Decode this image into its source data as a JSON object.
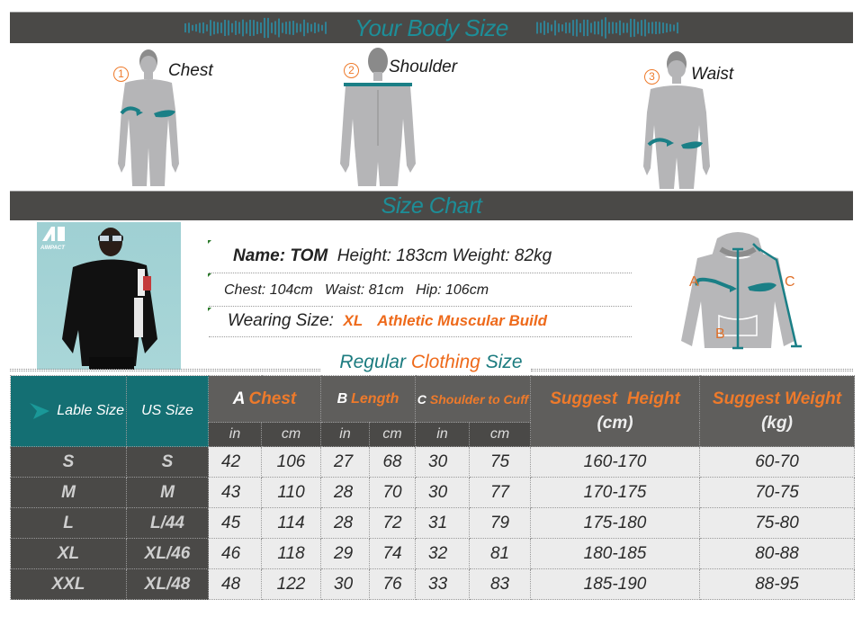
{
  "banners": {
    "body_size_title": "Your Body Size",
    "size_chart_title": "Size Chart"
  },
  "body_measurements": [
    {
      "number": "1",
      "label": "Chest",
      "icon": "chest-measure-figure"
    },
    {
      "number": "2",
      "label": "Shoulder",
      "icon": "shoulder-measure-figure"
    },
    {
      "number": "3",
      "label": "Waist",
      "icon": "waist-measure-figure"
    }
  ],
  "model": {
    "brand": "AIMPACT",
    "name_label": "Name:",
    "name": "TOM",
    "height_weight": "Height: 183cm Weight: 82kg",
    "measurements": "Chest: 104cm   Waist: 81cm   Hip: 106cm",
    "wearing_label": "Wearing Size:",
    "wearing_size": "XL",
    "build": "Athletic Muscular Build"
  },
  "garment_diagram": {
    "labels": [
      "A",
      "B",
      "C"
    ]
  },
  "subheading": {
    "part1": "Regular",
    "part2": "Clothing",
    "part3": "Size"
  },
  "table": {
    "headers": {
      "label_size": "Lable Size",
      "us_size": "US Size",
      "chest_letter": "A",
      "chest": "Chest",
      "length_letter": "B",
      "length": "Length",
      "shoulder_letter": "C",
      "shoulder": "Shoulder to Cuff",
      "height": "Suggest  Height",
      "height_unit": "(cm)",
      "weight": "Suggest Weight",
      "weight_unit": "(kg)",
      "unit_in": "in",
      "unit_cm": "cm"
    },
    "rows": [
      {
        "label": "S",
        "us": "S",
        "chest_in": "42",
        "chest_cm": "106",
        "length_in": "27",
        "length_cm": "68",
        "shoulder_in": "30",
        "shoulder_cm": "75",
        "height": "160-170",
        "weight": "60-70"
      },
      {
        "label": "M",
        "us": "M",
        "chest_in": "43",
        "chest_cm": "110",
        "length_in": "28",
        "length_cm": "70",
        "shoulder_in": "30",
        "shoulder_cm": "77",
        "height": "170-175",
        "weight": "70-75"
      },
      {
        "label": "L",
        "us": "L/44",
        "chest_in": "45",
        "chest_cm": "114",
        "length_in": "28",
        "length_cm": "72",
        "shoulder_in": "31",
        "shoulder_cm": "79",
        "height": "175-180",
        "weight": "75-80"
      },
      {
        "label": "XL",
        "us": "XL/46",
        "chest_in": "46",
        "chest_cm": "118",
        "length_in": "29",
        "length_cm": "74",
        "shoulder_in": "32",
        "shoulder_cm": "81",
        "height": "180-185",
        "weight": "80-88"
      },
      {
        "label": "XXL",
        "us": "XL/48",
        "chest_in": "48",
        "chest_cm": "122",
        "length_in": "30",
        "length_cm": "76",
        "shoulder_in": "33",
        "shoulder_cm": "83",
        "height": "185-190",
        "weight": "88-95"
      }
    ]
  },
  "colors": {
    "teal": "#1d8e98",
    "orange": "#ee7a2b",
    "dark_grey": "#4a4947",
    "header_teal": "#146f73"
  }
}
